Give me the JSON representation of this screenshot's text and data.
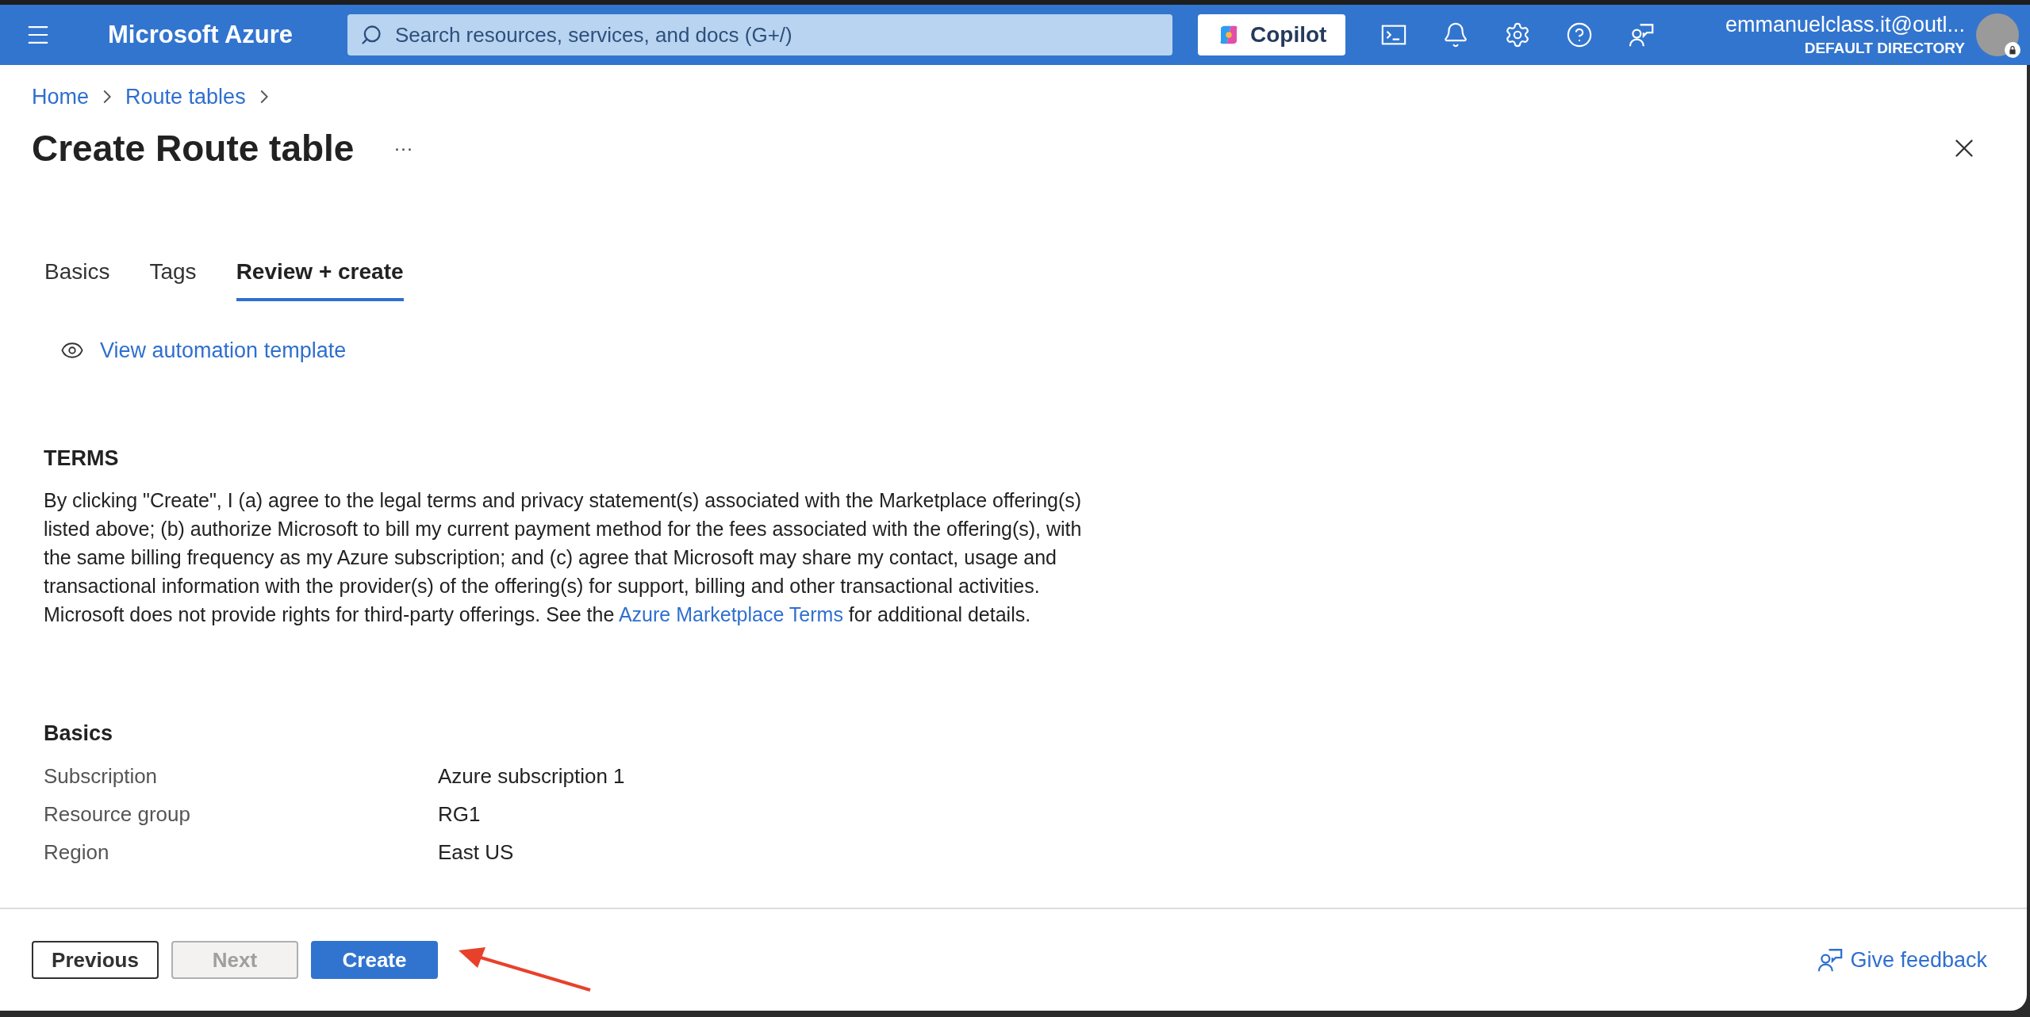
{
  "topbar": {
    "brand": "Microsoft Azure",
    "search": {
      "placeholder": "Search resources, services, and docs (G+/)"
    },
    "copilot": "Copilot",
    "user": {
      "email": "emmanuelclass.it@outl...",
      "directory": "DEFAULT DIRECTORY"
    }
  },
  "breadcrumb": [
    "Home",
    "Route tables"
  ],
  "page": {
    "title": "Create Route table",
    "more": "···"
  },
  "tabs": [
    {
      "label": "Basics",
      "selected": false
    },
    {
      "label": "Tags",
      "selected": false
    },
    {
      "label": "Review + create",
      "selected": true
    }
  ],
  "automation_link": "View automation template",
  "terms": {
    "heading": "TERMS",
    "before": "By clicking \"Create\", I (a) agree to the legal terms and privacy statement(s) associated with the Marketplace offering(s) listed above; (b) authorize Microsoft to bill my current payment method for the fees associated with the offering(s), with the same billing frequency as my Azure subscription; and (c) agree that Microsoft may share my contact, usage and transactional information with the provider(s) of the offering(s) for support, billing and other transactional activities. Microsoft does not provide rights for third-party offerings. See the",
    "link": "Azure Marketplace Terms",
    "after": "for additional details."
  },
  "basics": {
    "heading": "Basics",
    "rows": [
      {
        "label": "Subscription",
        "value": "Azure subscription 1"
      },
      {
        "label": "Resource group",
        "value": "RG1"
      },
      {
        "label": "Region",
        "value": "East US"
      }
    ]
  },
  "footer": {
    "buttons": [
      {
        "label": "Previous",
        "kind": "secondary",
        "disabled": false
      },
      {
        "label": "Next",
        "kind": "secondary",
        "disabled": true
      },
      {
        "label": "Create",
        "kind": "primary",
        "disabled": false
      }
    ],
    "feedback": "Give feedback"
  }
}
